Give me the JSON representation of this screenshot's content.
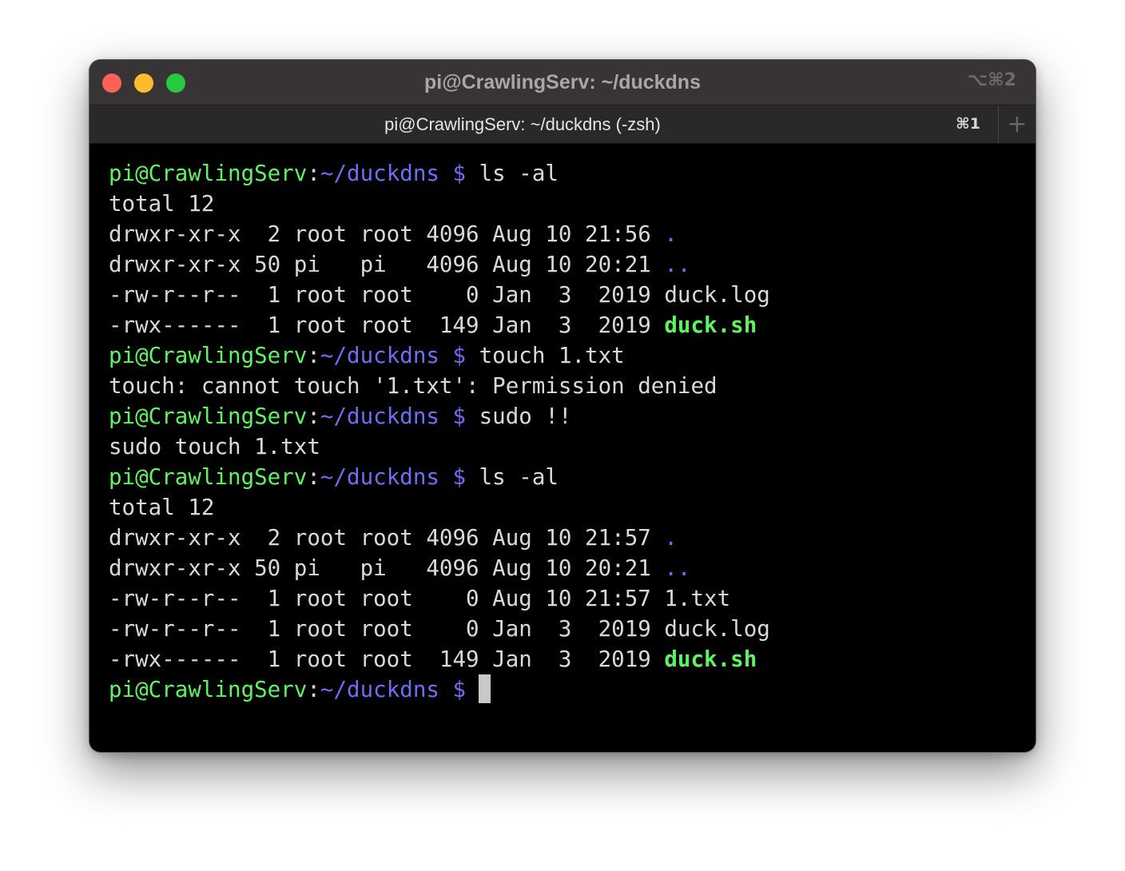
{
  "window": {
    "title": "pi@CrawlingServ: ~/duckdns",
    "shortcut": "⌥⌘2"
  },
  "tab": {
    "title": "pi@CrawlingServ: ~/duckdns (-zsh)",
    "shortcut": "⌘1",
    "new_tab": "+"
  },
  "prompt": {
    "user": "pi@CrawlingServ",
    "sep": ":",
    "path": "~/duckdns $"
  },
  "colors": {
    "prompt_user": "#5cf55f",
    "prompt_path": "#6f6cf5",
    "text": "#d9d9d9",
    "background": "#000000"
  },
  "lines": [
    {
      "type": "prompt",
      "cmd": " ls -al"
    },
    {
      "type": "output",
      "text": "total 12"
    },
    {
      "type": "ls",
      "meta": "drwxr-xr-x  2 root root 4096 Aug 10 21:56 ",
      "name": ".",
      "kind": "dir"
    },
    {
      "type": "ls",
      "meta": "drwxr-xr-x 50 pi   pi   4096 Aug 10 20:21 ",
      "name": "..",
      "kind": "dir"
    },
    {
      "type": "ls",
      "meta": "-rw-r--r--  1 root root    0 Jan  3  2019 ",
      "name": "duck.log",
      "kind": "file"
    },
    {
      "type": "ls",
      "meta": "-rwx------  1 root root  149 Jan  3  2019 ",
      "name": "duck.sh",
      "kind": "exec"
    },
    {
      "type": "prompt",
      "cmd": " touch 1.txt"
    },
    {
      "type": "output",
      "text": "touch: cannot touch '1.txt': Permission denied"
    },
    {
      "type": "prompt",
      "cmd": " sudo !!"
    },
    {
      "type": "output",
      "text": "sudo touch 1.txt"
    },
    {
      "type": "prompt",
      "cmd": " ls -al"
    },
    {
      "type": "output",
      "text": "total 12"
    },
    {
      "type": "ls",
      "meta": "drwxr-xr-x  2 root root 4096 Aug 10 21:57 ",
      "name": ".",
      "kind": "dir"
    },
    {
      "type": "ls",
      "meta": "drwxr-xr-x 50 pi   pi   4096 Aug 10 20:21 ",
      "name": "..",
      "kind": "dir"
    },
    {
      "type": "ls",
      "meta": "-rw-r--r--  1 root root    0 Aug 10 21:57 ",
      "name": "1.txt",
      "kind": "file"
    },
    {
      "type": "ls",
      "meta": "-rw-r--r--  1 root root    0 Jan  3  2019 ",
      "name": "duck.log",
      "kind": "file"
    },
    {
      "type": "ls",
      "meta": "-rwx------  1 root root  149 Jan  3  2019 ",
      "name": "duck.sh",
      "kind": "exec"
    },
    {
      "type": "prompt",
      "cmd": "",
      "cursor": true
    }
  ]
}
